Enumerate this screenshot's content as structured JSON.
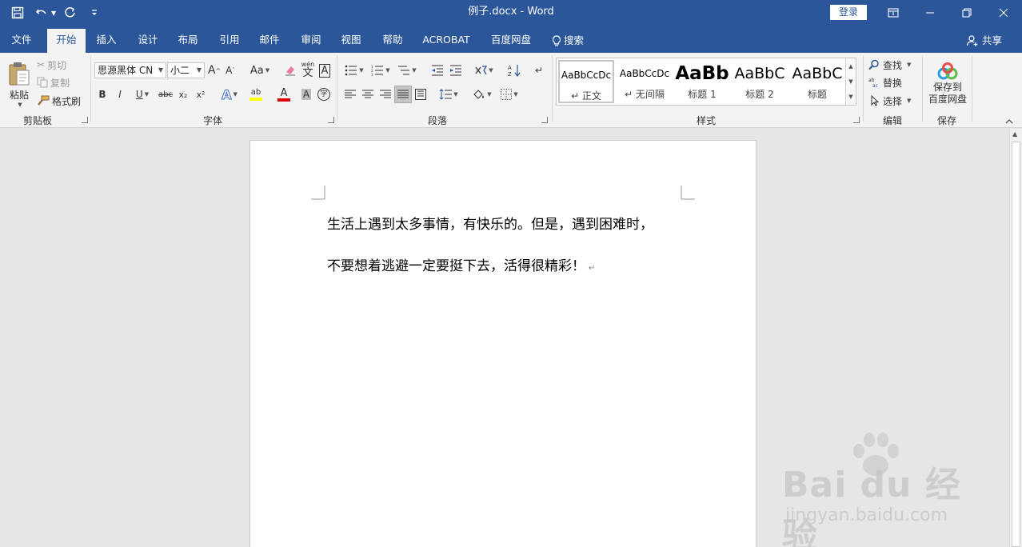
{
  "window": {
    "title": "例子.docx  -  Word",
    "login_label": "登录"
  },
  "tabs": {
    "items": [
      {
        "label": "文件"
      },
      {
        "label": "开始"
      },
      {
        "label": "插入"
      },
      {
        "label": "设计"
      },
      {
        "label": "布局"
      },
      {
        "label": "引用"
      },
      {
        "label": "邮件"
      },
      {
        "label": "审阅"
      },
      {
        "label": "视图"
      },
      {
        "label": "帮助"
      },
      {
        "label": "ACROBAT"
      },
      {
        "label": "百度网盘"
      },
      {
        "label": "搜索"
      }
    ],
    "active": "开始",
    "share_label": "共享"
  },
  "clipboard": {
    "paste_label": "粘贴",
    "cut_label": "剪切",
    "copy_label": "复制",
    "format_painter_label": "格式刷",
    "group_label": "剪贴板"
  },
  "font": {
    "font_name": "思源黑体 CN",
    "font_size": "小二",
    "case_label": "Aa",
    "phonetic_label": "wén",
    "border_char_label": "A",
    "bold_label": "B",
    "italic_label": "I",
    "underline_label": "U",
    "strike_label": "abc",
    "sub_label": "x₂",
    "sup_label": "x²",
    "effect_label": "A",
    "highlight_label": "ab",
    "color_label": "A",
    "shade_label": "A",
    "enclose_label": "字",
    "group_label": "字体"
  },
  "paragraph": {
    "group_label": "段落"
  },
  "styles": {
    "group_label": "样式",
    "items": [
      {
        "preview": "AaBbCcDc",
        "name": "↵ 正文"
      },
      {
        "preview": "AaBbCcDc",
        "name": "↵ 无间隔"
      },
      {
        "preview": "AaBb",
        "name": "标题 1"
      },
      {
        "preview": "AaBbC",
        "name": "标题 2"
      },
      {
        "preview": "AaBbC",
        "name": "标题"
      }
    ]
  },
  "editing": {
    "find_label": "查找",
    "replace_label": "替换",
    "select_label": "选择",
    "group_label": "编辑"
  },
  "save": {
    "button_label_line1": "保存到",
    "button_label_line2": "百度网盘",
    "group_label": "保存"
  },
  "document": {
    "paragraphs": [
      "生活上遇到太多事情，有快乐的。但是，遇到困难时，",
      "不要想着逃避一定要挺下去，活得很精彩！"
    ],
    "para_mark": "↵"
  },
  "watermark": {
    "logo_text": "Bai du 经验",
    "url": "jingyan.baidu.com"
  },
  "colors": {
    "title_bar": "#2b579a",
    "ribbon_bg": "#f3f3f3",
    "font_color_red": "#e00000",
    "highlight_yellow": "#ffff00"
  }
}
